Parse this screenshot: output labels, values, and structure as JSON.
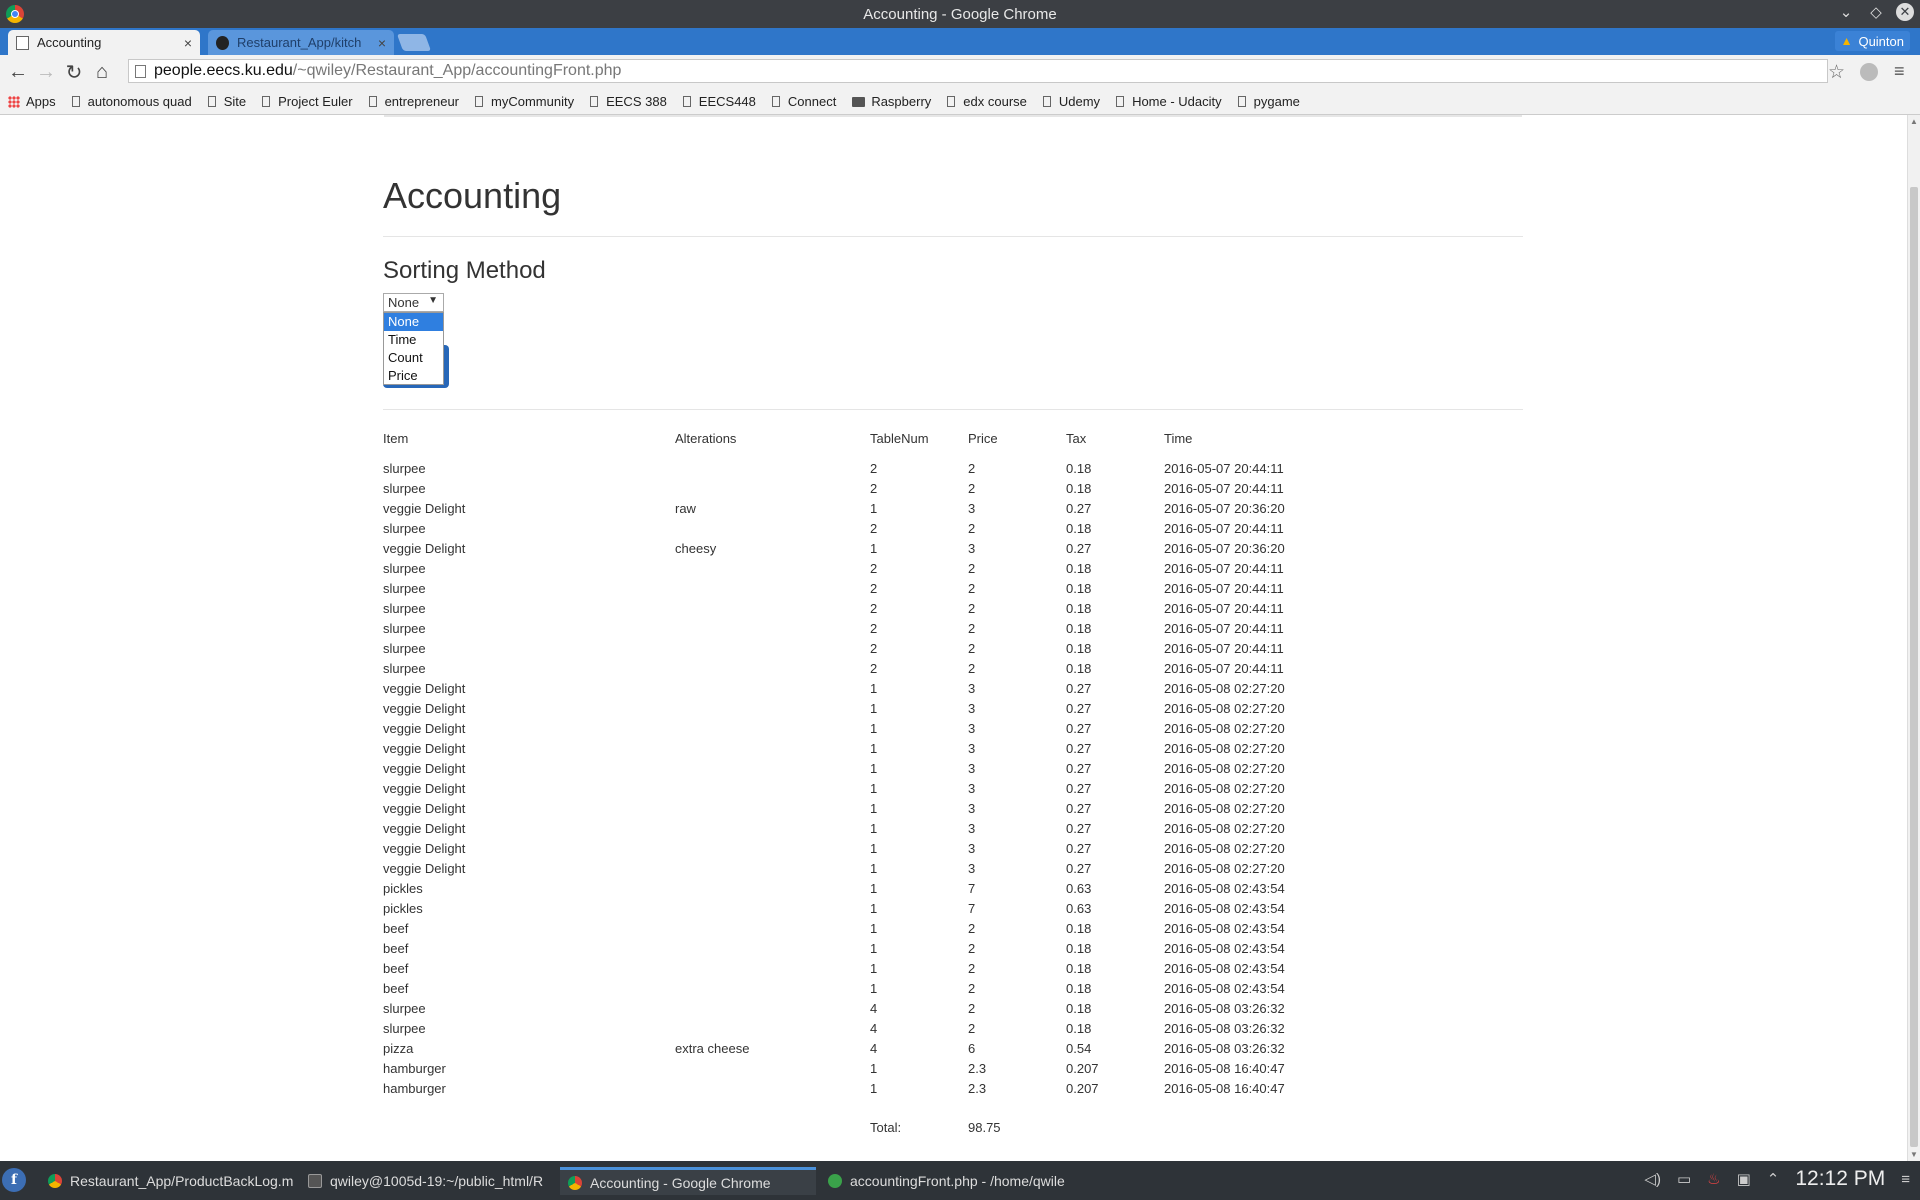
{
  "window": {
    "title": "Accounting - Google Chrome",
    "controls": [
      "⌄",
      "◇",
      "✕"
    ]
  },
  "tabs": [
    {
      "title": "Accounting",
      "close": "×"
    },
    {
      "title": "Restaurant_App/kitch",
      "close": "×"
    }
  ],
  "profile": {
    "name": "Quinton",
    "warning": "▲"
  },
  "toolbar": {
    "back": "←",
    "forward": "→",
    "reload": "↻",
    "home": "⌂",
    "url_host": "people.eecs.ku.edu",
    "url_path": "/~qwiley/Restaurant_App/accountingFront.php",
    "star": "☆",
    "menu": "≡"
  },
  "bookmarks": [
    {
      "label": "Apps",
      "icon": "apps-grid-icon"
    },
    {
      "label": "autonomous quad",
      "icon": "page-icon"
    },
    {
      "label": "Site",
      "icon": "page-icon"
    },
    {
      "label": "Project Euler",
      "icon": "page-icon"
    },
    {
      "label": "entrepreneur",
      "icon": "page-icon"
    },
    {
      "label": "myCommunity",
      "icon": "page-icon"
    },
    {
      "label": "EECS 388",
      "icon": "page-icon"
    },
    {
      "label": "EECS448",
      "icon": "page-icon"
    },
    {
      "label": "Connect",
      "icon": "page-icon"
    },
    {
      "label": "Raspberry",
      "icon": "folder-icon"
    },
    {
      "label": "edx course",
      "icon": "page-icon"
    },
    {
      "label": "Udemy",
      "icon": "page-icon"
    },
    {
      "label": "Home - Udacity",
      "icon": "page-icon"
    },
    {
      "label": "pygame",
      "icon": "page-icon"
    }
  ],
  "page": {
    "heading": "Accounting",
    "sorting_title": "Sorting Method",
    "select": {
      "value": "None",
      "arrow": "▼",
      "options": [
        "None",
        "Time",
        "Count",
        "Price"
      ]
    },
    "table": {
      "headers": [
        "Item",
        "Alterations",
        "TableNum",
        "Price",
        "Tax",
        "Time"
      ],
      "rows": [
        [
          "slurpee",
          "",
          "2",
          "2",
          "0.18",
          "2016-05-07 20:44:11"
        ],
        [
          "slurpee",
          "",
          "2",
          "2",
          "0.18",
          "2016-05-07 20:44:11"
        ],
        [
          "veggie Delight",
          "raw",
          "1",
          "3",
          "0.27",
          "2016-05-07 20:36:20"
        ],
        [
          "slurpee",
          "",
          "2",
          "2",
          "0.18",
          "2016-05-07 20:44:11"
        ],
        [
          "veggie Delight",
          "cheesy",
          "1",
          "3",
          "0.27",
          "2016-05-07 20:36:20"
        ],
        [
          "slurpee",
          "",
          "2",
          "2",
          "0.18",
          "2016-05-07 20:44:11"
        ],
        [
          "slurpee",
          "",
          "2",
          "2",
          "0.18",
          "2016-05-07 20:44:11"
        ],
        [
          "slurpee",
          "",
          "2",
          "2",
          "0.18",
          "2016-05-07 20:44:11"
        ],
        [
          "slurpee",
          "",
          "2",
          "2",
          "0.18",
          "2016-05-07 20:44:11"
        ],
        [
          "slurpee",
          "",
          "2",
          "2",
          "0.18",
          "2016-05-07 20:44:11"
        ],
        [
          "slurpee",
          "",
          "2",
          "2",
          "0.18",
          "2016-05-07 20:44:11"
        ],
        [
          "veggie Delight",
          "",
          "1",
          "3",
          "0.27",
          "2016-05-08 02:27:20"
        ],
        [
          "veggie Delight",
          "",
          "1",
          "3",
          "0.27",
          "2016-05-08 02:27:20"
        ],
        [
          "veggie Delight",
          "",
          "1",
          "3",
          "0.27",
          "2016-05-08 02:27:20"
        ],
        [
          "veggie Delight",
          "",
          "1",
          "3",
          "0.27",
          "2016-05-08 02:27:20"
        ],
        [
          "veggie Delight",
          "",
          "1",
          "3",
          "0.27",
          "2016-05-08 02:27:20"
        ],
        [
          "veggie Delight",
          "",
          "1",
          "3",
          "0.27",
          "2016-05-08 02:27:20"
        ],
        [
          "veggie Delight",
          "",
          "1",
          "3",
          "0.27",
          "2016-05-08 02:27:20"
        ],
        [
          "veggie Delight",
          "",
          "1",
          "3",
          "0.27",
          "2016-05-08 02:27:20"
        ],
        [
          "veggie Delight",
          "",
          "1",
          "3",
          "0.27",
          "2016-05-08 02:27:20"
        ],
        [
          "veggie Delight",
          "",
          "1",
          "3",
          "0.27",
          "2016-05-08 02:27:20"
        ],
        [
          "pickles",
          "",
          "1",
          "7",
          "0.63",
          "2016-05-08 02:43:54"
        ],
        [
          "pickles",
          "",
          "1",
          "7",
          "0.63",
          "2016-05-08 02:43:54"
        ],
        [
          "beef",
          "",
          "1",
          "2",
          "0.18",
          "2016-05-08 02:43:54"
        ],
        [
          "beef",
          "",
          "1",
          "2",
          "0.18",
          "2016-05-08 02:43:54"
        ],
        [
          "beef",
          "",
          "1",
          "2",
          "0.18",
          "2016-05-08 02:43:54"
        ],
        [
          "beef",
          "",
          "1",
          "2",
          "0.18",
          "2016-05-08 02:43:54"
        ],
        [
          "slurpee",
          "",
          "4",
          "2",
          "0.18",
          "2016-05-08 03:26:32"
        ],
        [
          "slurpee",
          "",
          "4",
          "2",
          "0.18",
          "2016-05-08 03:26:32"
        ],
        [
          "pizza",
          "extra cheese",
          "4",
          "6",
          "0.54",
          "2016-05-08 03:26:32"
        ],
        [
          "hamburger",
          "",
          "1",
          "2.3",
          "0.207",
          "2016-05-08 16:40:47"
        ],
        [
          "hamburger",
          "",
          "1",
          "2.3",
          "0.207",
          "2016-05-08 16:40:47"
        ]
      ],
      "total_label": "Total:",
      "total_value": "98.75"
    }
  },
  "taskbar": {
    "launcher": "f",
    "tasks": [
      {
        "label": "Restaurant_App/ProductBackLog.m",
        "icon": "chrome-icon"
      },
      {
        "label": "qwiley@1005d-19:~/public_html/R",
        "icon": "terminal-icon"
      },
      {
        "label": "Accounting - Google Chrome",
        "icon": "chrome-icon"
      },
      {
        "label": "accountingFront.php - /home/qwile",
        "icon": "editor-icon"
      }
    ],
    "clock": "12:12 PM"
  },
  "colors": {
    "tab_strip": "#2f76c9",
    "selected_option": "#2f7fe0",
    "taskbar": "#2e3338"
  }
}
